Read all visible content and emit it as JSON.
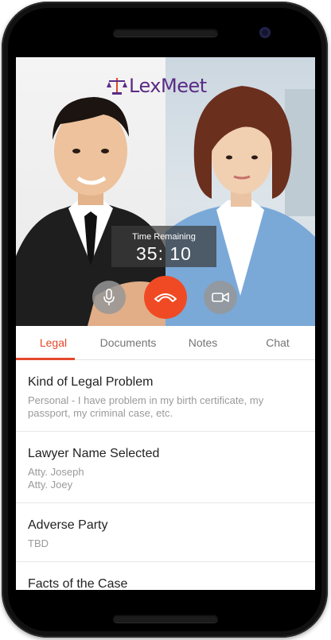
{
  "app": {
    "name": "LexMeet",
    "brand_color": "#5b2b85",
    "accent_color": "#e5482a"
  },
  "call": {
    "timer_label": "Time Remaining",
    "timer_value": "35: 10",
    "controls": [
      {
        "name": "microphone",
        "icon": "microphone-icon"
      },
      {
        "name": "end-call",
        "icon": "phone-hangup-icon",
        "color": "#f04a24"
      },
      {
        "name": "camera",
        "icon": "video-camera-icon"
      }
    ]
  },
  "tabs": [
    {
      "label": "Legal",
      "active": true
    },
    {
      "label": "Documents",
      "active": false
    },
    {
      "label": "Notes",
      "active": false
    },
    {
      "label": "Chat",
      "active": false
    }
  ],
  "details": [
    {
      "title": "Kind of Legal Problem",
      "value": "Personal - I have problem in my birth certificate, my passport, my criminal case, etc."
    },
    {
      "title": "Lawyer Name Selected",
      "value_lines": [
        "Atty. Joseph",
        "Atty. Joey"
      ]
    },
    {
      "title": "Adverse Party",
      "value": "TBD"
    },
    {
      "title": "Facts of the Case"
    }
  ]
}
